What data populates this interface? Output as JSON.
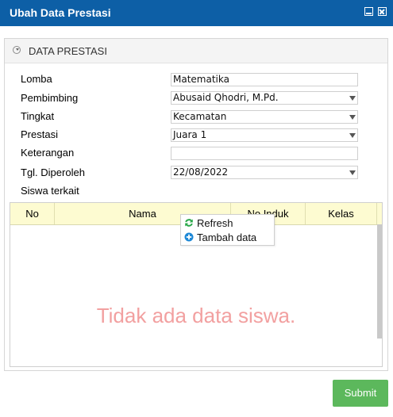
{
  "window": {
    "title": "Ubah Data Prestasi"
  },
  "section": {
    "title": "DATA PRESTASI"
  },
  "form": {
    "lomba": {
      "label": "Lomba",
      "value": "Matematika"
    },
    "pembimbing": {
      "label": "Pembimbing",
      "value": "Abusaid Qhodri, M.Pd."
    },
    "tingkat": {
      "label": "Tingkat",
      "value": "Kecamatan"
    },
    "prestasi": {
      "label": "Prestasi",
      "value": "Juara 1"
    },
    "keterangan": {
      "label": "Keterangan",
      "value": ""
    },
    "tgl": {
      "label": "Tgl. Diperoleh",
      "value": "22/08/2022"
    },
    "siswa_label": "Siswa terkait"
  },
  "table": {
    "columns": [
      "No",
      "Nama",
      "No Induk",
      "Kelas"
    ],
    "empty_message": "Tidak ada data siswa."
  },
  "context_menu": {
    "items": [
      {
        "label": "Refresh",
        "icon": "refresh-icon",
        "color": "#2aa84a"
      },
      {
        "label": "Tambah data",
        "icon": "add-icon",
        "color": "#1e88d6"
      }
    ]
  },
  "buttons": {
    "submit": "Submit"
  },
  "colors": {
    "titlebar": "#0d5fa6",
    "submit": "#5cb85c",
    "grid_header": "#fdfbd1",
    "empty_text": "#f2a0a0"
  }
}
